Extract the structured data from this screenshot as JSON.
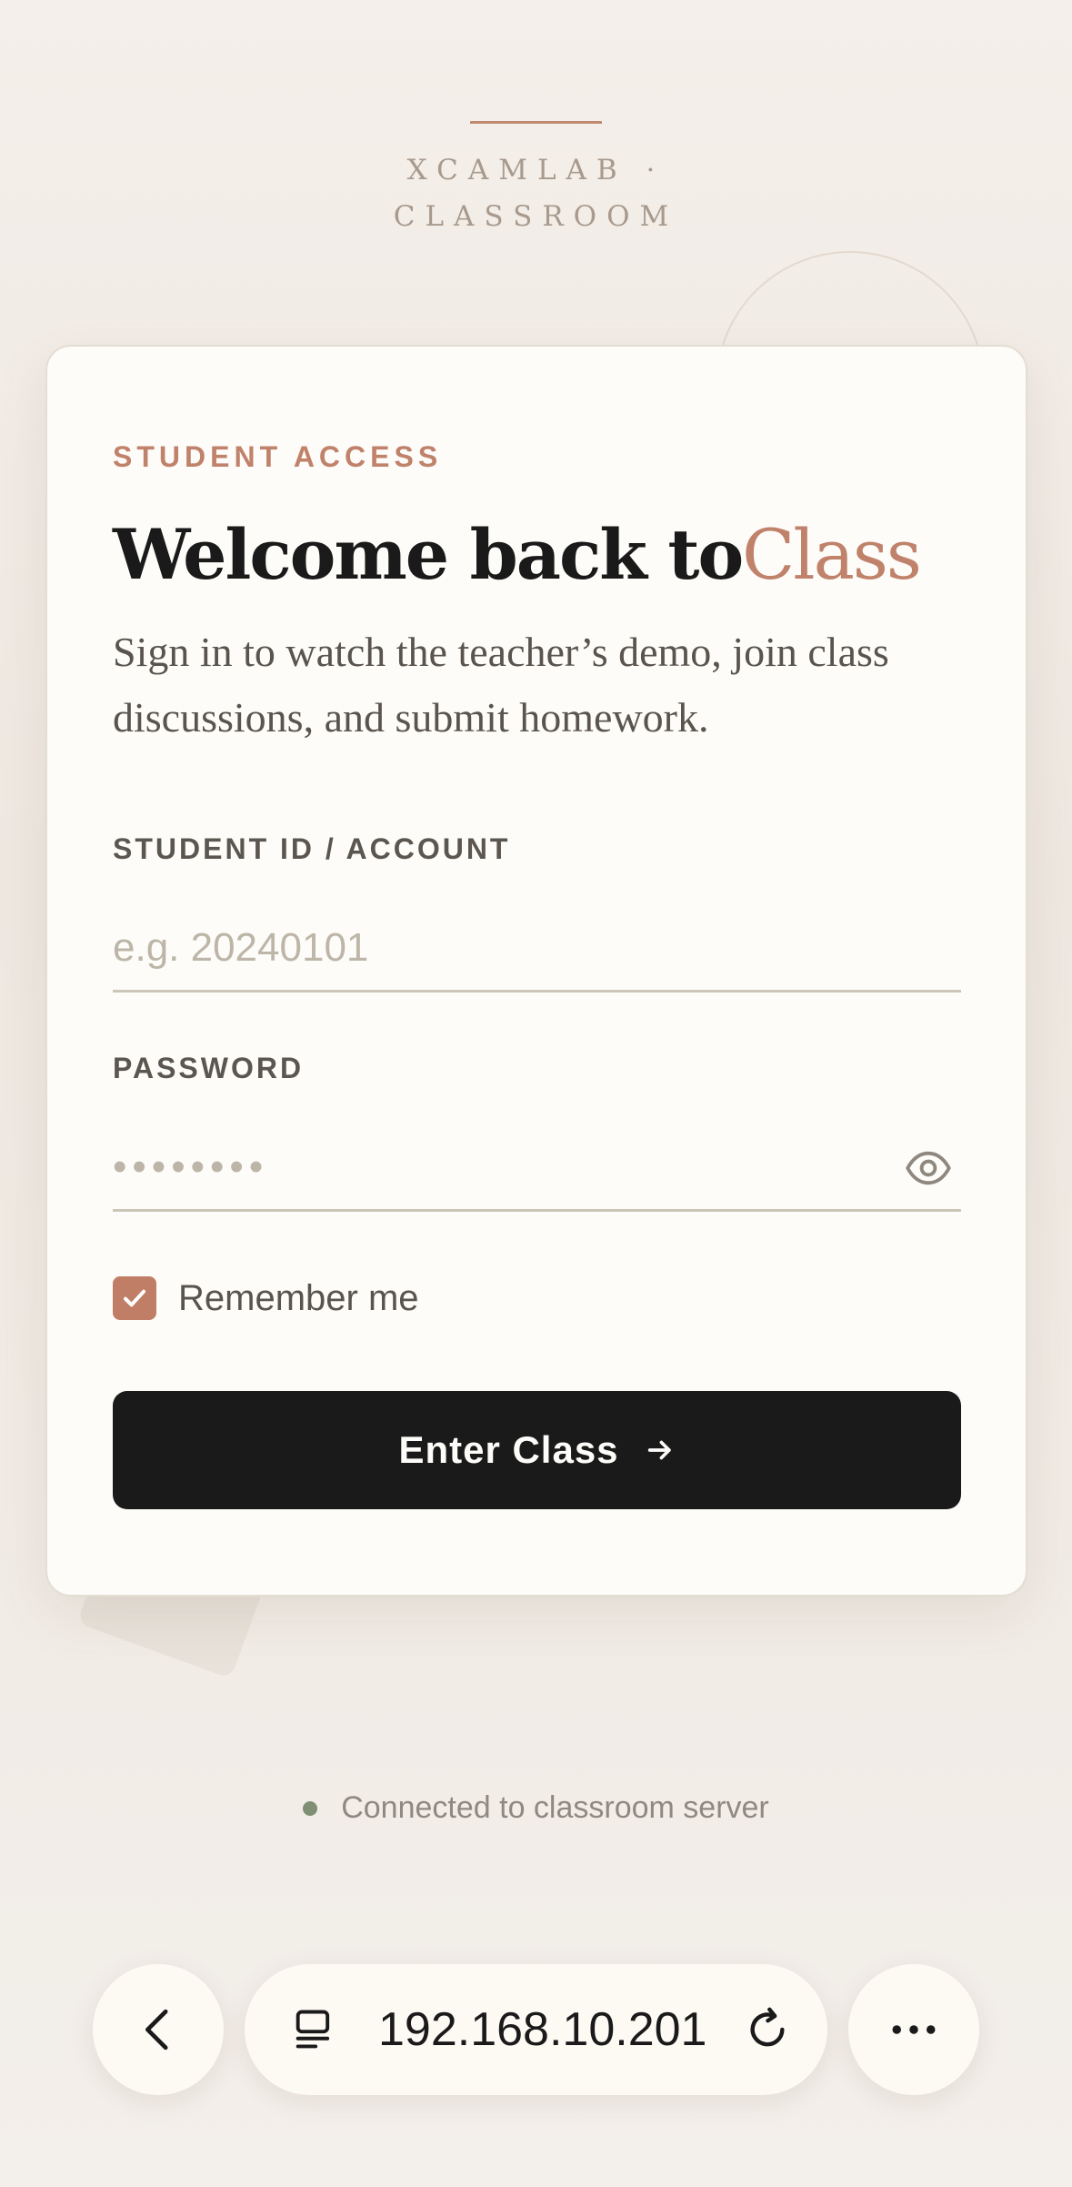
{
  "brand": {
    "line1": "XCAMLAB ·",
    "line2": "CLASSROOM"
  },
  "card": {
    "eyebrow": "STUDENT ACCESS",
    "title_main": "Welcome back to",
    "title_accent": "Class",
    "subtitle": "Sign in to watch the teacher’s demo, join class discussions, and submit homework.",
    "student_id": {
      "label": "STUDENT ID / ACCOUNT",
      "placeholder": "e.g. 20240101",
      "value": ""
    },
    "password": {
      "label": "PASSWORD",
      "value": "••••••••",
      "toggle_icon": "eye-icon"
    },
    "remember": {
      "label": "Remember me",
      "checked": true
    },
    "submit": {
      "label": "Enter Class",
      "icon": "arrow-right-icon"
    }
  },
  "status": {
    "text": "Connected to classroom server",
    "color": "#7e8f74"
  },
  "browser": {
    "url": "192.168.10.201",
    "back_icon": "chevron-left-icon",
    "tabs_icon": "tabs-icon",
    "reload_icon": "reload-icon",
    "more_icon": "more-horizontal-icon"
  },
  "colors": {
    "accent": "#c0826a",
    "button": "#1a1a1a",
    "card": "#fdfcf9"
  }
}
